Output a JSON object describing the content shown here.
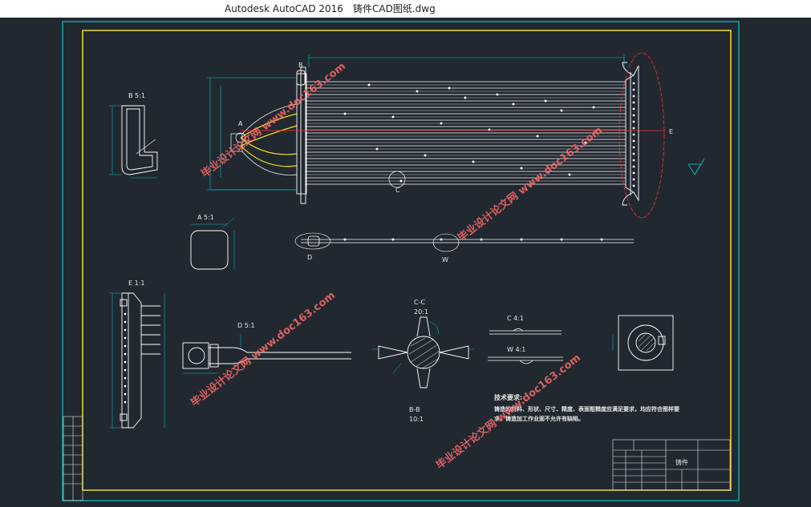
{
  "window": {
    "app_title": "Autodesk AutoCAD 2016",
    "file_name": "铸件CAD图纸.dwg"
  },
  "drawing": {
    "views": {
      "b_detail": "B 5:1",
      "a_detail": "A 5:1",
      "e_detail": "E 1:1",
      "d_detail": "D 5:1",
      "cc_section": "C-C",
      "cc_scale": "20:1",
      "bb_section": "B-B",
      "bb_scale": "10:1",
      "c_detail": "C 4:1",
      "w_detail": "W 4:1"
    },
    "callouts": {
      "a": "A",
      "b": "B",
      "c": "C",
      "d": "D",
      "e": "E",
      "w": "W"
    },
    "notes": {
      "heading": "技术要求:",
      "line1": "铸造的材料、形状、尺寸、精度、表面粗糙度应满足要求，均应符合图样要",
      "line2": "求，铸造加工作业面不允许有缺陷。"
    },
    "title_block": {
      "part_name": "铸件"
    },
    "watermark": "毕业设计论文网 www.doc163.com"
  },
  "colors": {
    "background": "#212830",
    "border_outer": "#00c8c8",
    "border_inner": "#f0e020",
    "geometry": "#ffffff",
    "dimension": "#00c8c8",
    "highlight": "#f0e020",
    "section_line": "#ff3030",
    "watermark": "#ff6a6a"
  }
}
